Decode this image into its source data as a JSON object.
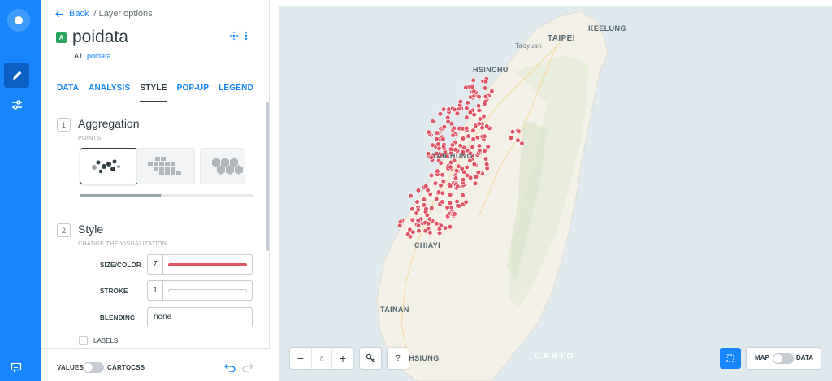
{
  "nav": {
    "back_label": "Back",
    "breadcrumb": "/ Layer options"
  },
  "layer": {
    "badge": "A",
    "name": "poidata",
    "source_id": "A1",
    "source_name": "poidata"
  },
  "tabs": [
    {
      "label": "DATA",
      "active": false
    },
    {
      "label": "ANALYSIS",
      "active": false
    },
    {
      "label": "STYLE",
      "active": true
    },
    {
      "label": "POP-UP",
      "active": false
    },
    {
      "label": "LEGEND",
      "active": false
    }
  ],
  "aggregation": {
    "number": "1",
    "title": "Aggregation",
    "caption": "POINTS",
    "options": [
      "points",
      "squares",
      "hexabins"
    ],
    "selected": "points"
  },
  "style": {
    "number": "2",
    "title": "Style",
    "caption": "CHANGE THE VISUALIZATION",
    "size_color_label": "SIZE/COLOR",
    "size_value": "7",
    "fill_color": "#e05465",
    "stroke_label": "STROKE",
    "stroke_value": "1",
    "stroke_color": "#ffffff",
    "blending_label": "BLENDING",
    "blending_value": "none",
    "labels_label": "LABELS"
  },
  "footer": {
    "values_label": "VALUES",
    "cartocss_label": "CARTOCSS"
  },
  "map": {
    "cities": [
      "KEELUNG",
      "TAIPEI",
      "Taoyuan",
      "HSINCHU",
      "TAICHUNG",
      "CHIAYI",
      "TAINAN",
      "KAOHSIUNG"
    ],
    "zoom_level": "8",
    "search_label": "?",
    "attribution": "CARTO",
    "map_label": "MAP",
    "data_label": "DATA"
  },
  "colors": {
    "accent": "#1785fb",
    "point": "#e05465",
    "land": "#f2f0e6",
    "water": "#dfe9ee"
  }
}
